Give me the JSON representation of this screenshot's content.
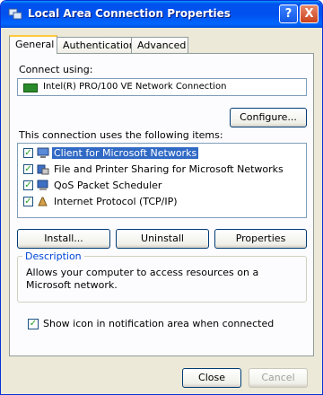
{
  "window": {
    "title": "Local Area Connection Properties",
    "help_label": "?",
    "close_label": "X"
  },
  "tabs": [
    {
      "label": "General"
    },
    {
      "label": "Authentication"
    },
    {
      "label": "Advanced"
    }
  ],
  "general": {
    "connect_using_label": "Connect using:",
    "adapter_name": "Intel(R) PRO/100 VE Network Connection",
    "configure_label": "Configure...",
    "components_label": "This connection uses the following items:",
    "components": [
      {
        "label": "Client for Microsoft Networks",
        "checked": true,
        "selected": true
      },
      {
        "label": "File and Printer Sharing for Microsoft Networks",
        "checked": true,
        "selected": false
      },
      {
        "label": "QoS Packet Scheduler",
        "checked": true,
        "selected": false
      },
      {
        "label": "Internet Protocol (TCP/IP)",
        "checked": true,
        "selected": false
      }
    ],
    "install_label": "Install...",
    "uninstall_label": "Uninstall",
    "properties_label": "Properties",
    "description_title": "Description",
    "description_text": "Allows your computer to access resources on a Microsoft network.",
    "show_icon_label": "Show icon in notification area when connected",
    "show_icon_checked": true
  },
  "footer": {
    "close_label": "Close",
    "cancel_label": "Cancel"
  },
  "check_glyph": "✓"
}
